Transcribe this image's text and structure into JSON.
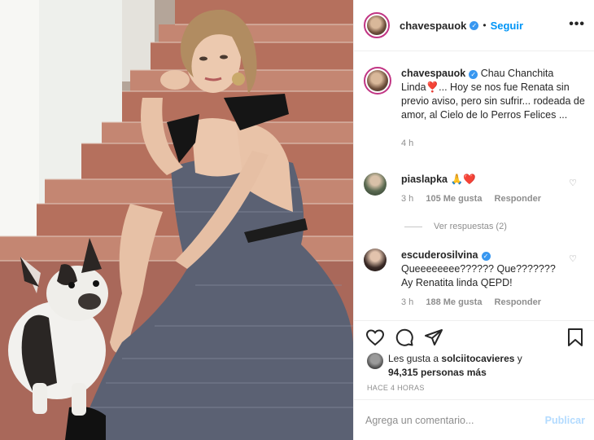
{
  "header": {
    "username": "chavespauok",
    "separator": "•",
    "follow_label": "Seguir",
    "more_label": "•••"
  },
  "caption": {
    "username": "chavespauok",
    "text": "Chau Chanchita Linda❣️... Hoy se nos fue Renata sin previo aviso, pero sin sufrir... rodeada de amor, al Cielo de lo Perros Felices ...",
    "time": "4 h"
  },
  "comments": [
    {
      "username": "piaslapka",
      "text": "🙏❤️",
      "time": "3 h",
      "likes": "105 Me gusta",
      "reply_label": "Responder"
    },
    {
      "username": "escuderosilvina",
      "text": "Queeeeeeee?????? Que??????? Ay Renatita linda QEPD!",
      "time": "3 h",
      "likes": "188 Me gusta",
      "reply_label": "Responder"
    }
  ],
  "replies_label": "Ver respuestas (2)",
  "likes_line": {
    "prefix": "Les gusta a",
    "user": "solciitocavieres",
    "connector": "y",
    "count": "94,315 personas más"
  },
  "timestamp": "HACE 4 HORAS",
  "comment_box": {
    "placeholder": "Agrega un comentario...",
    "publish_label": "Publicar"
  },
  "icons": {
    "like": "heart-icon",
    "comment": "comment-icon",
    "share": "share-icon",
    "save": "bookmark-icon",
    "verified": "verified-badge-icon"
  },
  "colors": {
    "accent": "#0095f6",
    "verified": "#3897f0",
    "muted": "#8e8e8e",
    "publish_disabled": "#b3dbff"
  }
}
